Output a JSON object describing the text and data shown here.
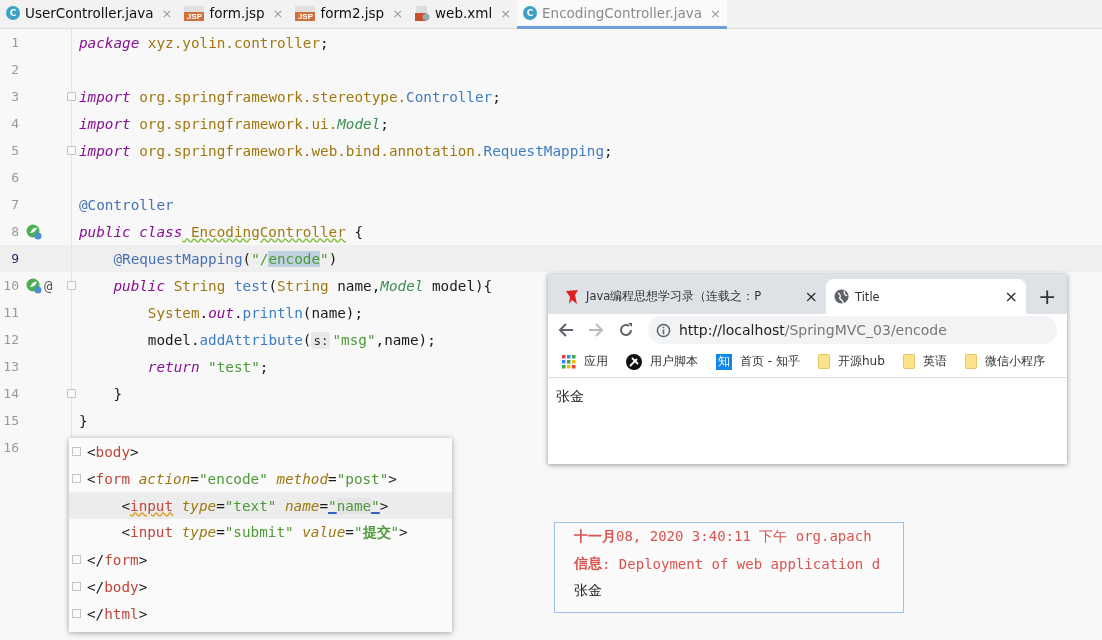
{
  "editor_tabs": [
    {
      "label": "UserController.java",
      "kind": "java",
      "icon_text": "C",
      "close": "×",
      "selected": false
    },
    {
      "label": "form.jsp",
      "kind": "jsp",
      "icon_text": "JSP",
      "close": "×",
      "selected": false
    },
    {
      "label": "form2.jsp",
      "kind": "jsp",
      "icon_text": "JSP",
      "close": "×",
      "selected": false
    },
    {
      "label": "web.xml",
      "kind": "xml",
      "close": "×",
      "selected": false
    },
    {
      "label": "EncodingController.java",
      "kind": "java",
      "icon_text": "C",
      "close": "×",
      "selected": true
    }
  ],
  "code_lines": [
    {
      "number": "1",
      "current": false,
      "bean_icon": false,
      "fold": false,
      "tokens": [
        {
          "kind": "kw",
          "text": "package"
        },
        {
          "kind": "pkg",
          "text": " xyz.yolin.controller"
        },
        {
          "kind": "plain",
          "text": ";"
        }
      ]
    },
    {
      "number": "2",
      "current": false,
      "bean_icon": false,
      "fold": false
    },
    {
      "number": "3",
      "current": false,
      "bean_icon": false,
      "fold": true,
      "tokens": [
        {
          "kind": "kw",
          "text": "import"
        },
        {
          "kind": "pkg",
          "text": " org.springframework.stereotype."
        },
        {
          "kind": "ref",
          "text": "Controller"
        },
        {
          "kind": "plain",
          "text": ";"
        }
      ]
    },
    {
      "number": "4",
      "current": false,
      "bean_icon": false,
      "fold": false,
      "tokens": [
        {
          "kind": "kw",
          "text": "import"
        },
        {
          "kind": "pkg",
          "text": " org.springframework.ui."
        },
        {
          "kind": "iface",
          "text": "Model"
        },
        {
          "kind": "plain",
          "text": ";"
        }
      ]
    },
    {
      "number": "5",
      "current": false,
      "bean_icon": false,
      "fold": true,
      "tokens": [
        {
          "kind": "kw",
          "text": "import"
        },
        {
          "kind": "pkg",
          "text": " org.springframework.web.bind.annotation."
        },
        {
          "kind": "ref",
          "text": "RequestMapping"
        },
        {
          "kind": "plain",
          "text": ";"
        }
      ]
    },
    {
      "number": "6",
      "current": false,
      "bean_icon": false,
      "fold": false
    },
    {
      "number": "7",
      "current": false,
      "bean_icon": false,
      "fold": false,
      "tokens": [
        {
          "kind": "ann",
          "text": "@Controller"
        }
      ]
    },
    {
      "number": "8",
      "current": false,
      "bean_icon": true,
      "fold": false,
      "tokens": [
        {
          "kind": "kw",
          "text": "public class"
        },
        {
          "kind": "decl",
          "text": " EncodingController"
        },
        {
          "kind": "plain",
          "text": " {"
        }
      ]
    },
    {
      "number": "9",
      "current": true,
      "bean_icon": false,
      "fold": false,
      "tokens": [
        {
          "kind": "ann",
          "text": "    @RequestMapping"
        },
        {
          "kind": "plain",
          "text": "("
        },
        {
          "kind": "str",
          "text": "\"/"
        },
        {
          "kind": "selected",
          "text": "encode"
        },
        {
          "kind": "str",
          "text": "\""
        },
        {
          "kind": "plain",
          "text": ")"
        }
      ]
    },
    {
      "number": "10",
      "current": false,
      "bean_icon": true,
      "marker": "@",
      "fold": true,
      "tokens": [
        {
          "kind": "kw",
          "text": "    public"
        },
        {
          "kind": "type",
          "text": " String"
        },
        {
          "kind": "method",
          "text": " test"
        },
        {
          "kind": "plain",
          "text": "("
        },
        {
          "kind": "type",
          "text": "String"
        },
        {
          "kind": "plain",
          "text": " name,"
        },
        {
          "kind": "iface",
          "text": "Model"
        },
        {
          "kind": "plain",
          "text": " model){"
        }
      ]
    },
    {
      "number": "11",
      "current": false,
      "bean_icon": false,
      "fold": false,
      "tokens": [
        {
          "kind": "type",
          "text": "        System"
        },
        {
          "kind": "plain",
          "text": "."
        },
        {
          "kind": "field",
          "text": "out"
        },
        {
          "kind": "plain",
          "text": "."
        },
        {
          "kind": "method",
          "text": "println"
        },
        {
          "kind": "plain",
          "text": "(name);"
        }
      ]
    },
    {
      "number": "12",
      "current": false,
      "bean_icon": false,
      "fold": false,
      "tokens": [
        {
          "kind": "plain",
          "text": "        model."
        },
        {
          "kind": "method",
          "text": "addAttribute"
        },
        {
          "kind": "plain",
          "text": "("
        },
        {
          "kind": "hint",
          "text": "s:"
        },
        {
          "kind": "str",
          "text": "\"msg\""
        },
        {
          "kind": "plain",
          "text": ",name);"
        }
      ]
    },
    {
      "number": "13",
      "current": false,
      "bean_icon": false,
      "fold": false,
      "tokens": [
        {
          "kind": "kw",
          "text": "        return"
        },
        {
          "kind": "str",
          "text": " \"test\""
        },
        {
          "kind": "plain",
          "text": ";"
        }
      ]
    },
    {
      "number": "14",
      "current": false,
      "bean_icon": false,
      "fold": true,
      "tokens": [
        {
          "kind": "plain",
          "text": "    }"
        }
      ]
    },
    {
      "number": "15",
      "current": false,
      "bean_icon": false,
      "fold": false,
      "tokens": [
        {
          "kind": "plain",
          "text": "}"
        }
      ]
    },
    {
      "number": "16",
      "current": false,
      "bean_icon": false,
      "fold": false
    }
  ],
  "html_snippet": [
    {
      "current": false,
      "fold": true,
      "tokens": [
        {
          "kind": "plain",
          "text": "<"
        },
        {
          "kind": "tag",
          "text": "body"
        },
        {
          "kind": "plain",
          "text": ">"
        }
      ]
    },
    {
      "current": false,
      "fold": true,
      "tokens": [
        {
          "kind": "plain",
          "text": "<"
        },
        {
          "kind": "tag",
          "text": "form"
        },
        {
          "kind": "attr",
          "text": " action"
        },
        {
          "kind": "plain",
          "text": "="
        },
        {
          "kind": "str",
          "text": "\"encode\""
        },
        {
          "kind": "attr",
          "text": " method"
        },
        {
          "kind": "plain",
          "text": "="
        },
        {
          "kind": "str",
          "text": "\"post\""
        },
        {
          "kind": "plain",
          "text": ">"
        }
      ]
    },
    {
      "current": true,
      "fold": false,
      "tokens": [
        {
          "kind": "plain",
          "text": "    <"
        },
        {
          "kind": "tag_wavy",
          "text": "input"
        },
        {
          "kind": "attr",
          "text": " type"
        },
        {
          "kind": "plain",
          "text": "="
        },
        {
          "kind": "str",
          "text": "\"text\""
        },
        {
          "kind": "attr",
          "text": " name"
        },
        {
          "kind": "plain",
          "text": "="
        },
        {
          "kind": "quote",
          "text": "\""
        },
        {
          "kind": "selected_str",
          "text": "name"
        },
        {
          "kind": "quote",
          "text": "\""
        },
        {
          "kind": "plain",
          "text": ">"
        }
      ]
    },
    {
      "current": false,
      "fold": false,
      "tokens": [
        {
          "kind": "plain",
          "text": "    <"
        },
        {
          "kind": "tag",
          "text": "input"
        },
        {
          "kind": "attr",
          "text": " type"
        },
        {
          "kind": "plain",
          "text": "="
        },
        {
          "kind": "str",
          "text": "\"submit\""
        },
        {
          "kind": "attr",
          "text": " value"
        },
        {
          "kind": "plain",
          "text": "="
        },
        {
          "kind": "str",
          "text": "\""
        },
        {
          "kind": "str_bold",
          "text": "提交"
        },
        {
          "kind": "str",
          "text": "\""
        },
        {
          "kind": "plain",
          "text": ">"
        }
      ]
    },
    {
      "current": false,
      "fold": true,
      "tokens": [
        {
          "kind": "plain",
          "text": "</"
        },
        {
          "kind": "tag",
          "text": "form"
        },
        {
          "kind": "plain",
          "text": ">"
        }
      ]
    },
    {
      "current": false,
      "fold": true,
      "tokens": [
        {
          "kind": "plain",
          "text": "</"
        },
        {
          "kind": "tag",
          "text": "body"
        },
        {
          "kind": "plain",
          "text": ">"
        }
      ]
    },
    {
      "current": false,
      "fold": true,
      "tokens": [
        {
          "kind": "plain",
          "text": "</"
        },
        {
          "kind": "tag",
          "text": "html"
        },
        {
          "kind": "plain",
          "text": ">"
        }
      ]
    }
  ],
  "browser": {
    "tabs": [
      {
        "title": "Java编程思想学习录（连载之：P",
        "kind": "site",
        "selected": false,
        "close": "×"
      },
      {
        "title": "Title",
        "kind": "globe",
        "selected": true,
        "close": "×"
      }
    ],
    "new_tab": "+",
    "url_host": "http://localhost",
    "url_path": "/SpringMVC_03/encode",
    "forward_disabled": true,
    "bookmarks": [
      {
        "label": "应用",
        "kind": "apps"
      },
      {
        "label": "用户脚本",
        "kind": "userscript"
      },
      {
        "label": "首页 - 知乎",
        "kind": "zhihu",
        "icon_text": "知"
      },
      {
        "label": "开源hub",
        "kind": "folder"
      },
      {
        "label": "英语",
        "kind": "folder"
      },
      {
        "label": "微信小程序",
        "kind": "folder"
      }
    ],
    "content": "张金"
  },
  "console": {
    "lines": [
      {
        "kind": "log",
        "label": "十一月",
        "text": " 08, 2020 3:40:11 下午 org.apach"
      },
      {
        "kind": "log",
        "label": "信息",
        "text": ": Deployment of web application d"
      },
      {
        "kind": "output",
        "text": "张金"
      }
    ]
  }
}
